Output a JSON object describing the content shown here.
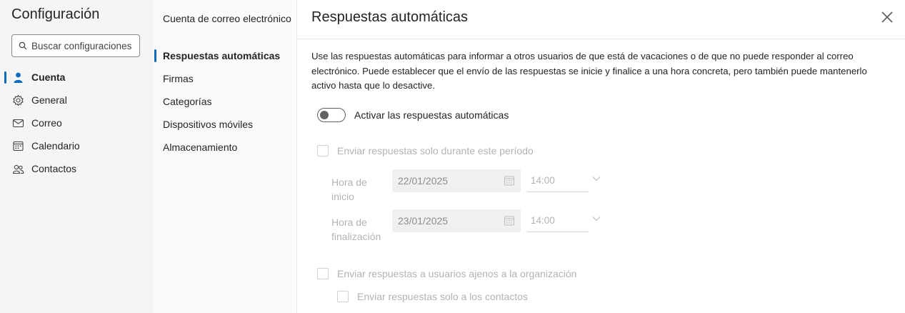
{
  "settings": {
    "title": "Configuración",
    "search_placeholder": "Buscar configuraciones",
    "nav": [
      {
        "label": "Cuenta",
        "icon": "person-icon",
        "active": true
      },
      {
        "label": "General",
        "icon": "gear-icon"
      },
      {
        "label": "Correo",
        "icon": "mail-icon"
      },
      {
        "label": "Calendario",
        "icon": "calendar-icon"
      },
      {
        "label": "Contactos",
        "icon": "people-icon"
      }
    ]
  },
  "subnav": [
    {
      "label": "Cuenta de correo electrónico"
    },
    {
      "label": "Respuestas automáticas",
      "active": true
    },
    {
      "label": "Firmas"
    },
    {
      "label": "Categorías"
    },
    {
      "label": "Dispositivos móviles"
    },
    {
      "label": "Almacenamiento"
    }
  ],
  "main": {
    "title": "Respuestas automáticas",
    "description": "Use las respuestas automáticas para informar a otros usuarios de que está de vacaciones o de que no puede responder al correo electrónico. Puede establecer que el envío de las respuestas se inicie y finalice a una hora concreta, pero también puede mantenerlo activo hasta que lo desactive.",
    "toggle_label": "Activar las respuestas automáticas",
    "toggle_on": false,
    "period_checkbox_label": "Enviar respuestas solo durante este período",
    "start": {
      "label": "Hora de inicio",
      "date": "22/01/2025",
      "time": "14:00"
    },
    "end": {
      "label": "Hora de finalización",
      "date": "23/01/2025",
      "time": "14:00"
    },
    "external_checkbox_label": "Enviar respuestas a usuarios ajenos a la organización",
    "contacts_checkbox_label": "Enviar respuestas solo a los contactos"
  },
  "colors": {
    "accent": "#0f6cbd",
    "disabled_text": "#b3b3b3"
  }
}
